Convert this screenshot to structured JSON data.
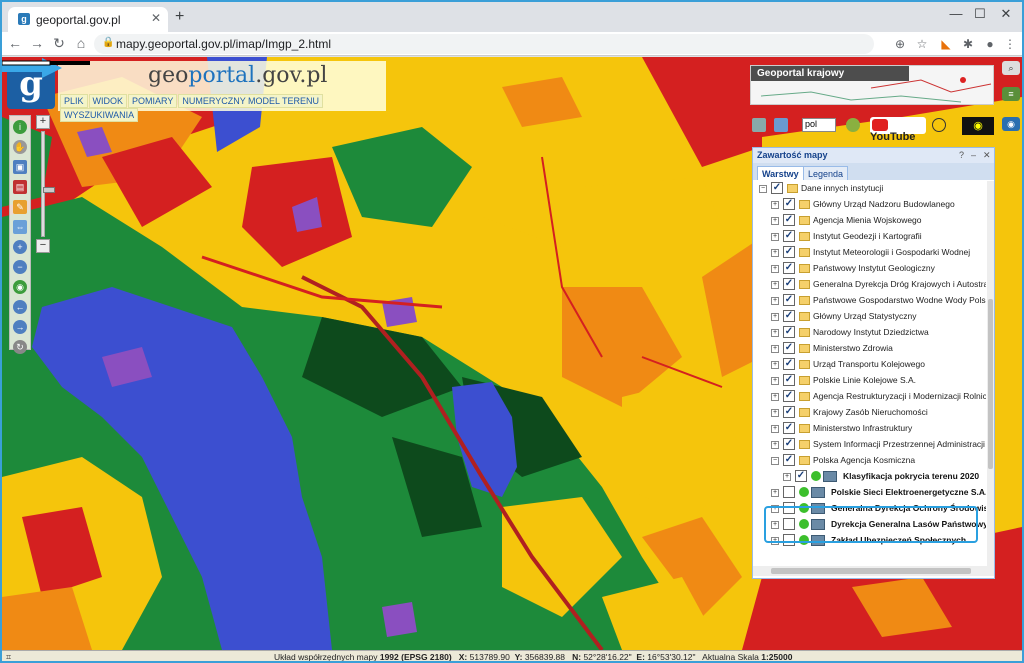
{
  "browser": {
    "tab_title": "geoportal.gov.pl",
    "url": "mapy.geoportal.gov.pl/imap/Imgp_2.html"
  },
  "app": {
    "brand_prefix": "geo",
    "brand_highlight": "portal",
    "brand_suffix": ".gov.pl",
    "menu": [
      "PLIK",
      "WIDOK",
      "POMIARY",
      "NUMERYCZNY MODEL TERENU",
      "WYSZUKIWANIA"
    ],
    "krajowy_title": "Geoportal krajowy",
    "language": "pol",
    "youtube_label": "YouTube"
  },
  "panel": {
    "title": "Zawartość mapy",
    "tab_layers": "Warstwy",
    "tab_legend": "Legenda",
    "rows": [
      {
        "label": "Dane innych instytucji",
        "level": 0,
        "exp": "−",
        "checked": true,
        "folder": true,
        "big": false
      },
      {
        "label": "Główny Urząd Nadzoru Budowlanego",
        "level": 1,
        "exp": "+",
        "checked": true,
        "folder": true,
        "big": false
      },
      {
        "label": "Agencja Mienia Wojskowego",
        "level": 1,
        "exp": "+",
        "checked": true,
        "folder": true,
        "big": false
      },
      {
        "label": "Instytut Geodezji i Kartografii",
        "level": 1,
        "exp": "+",
        "checked": true,
        "folder": true,
        "big": false
      },
      {
        "label": "Instytut Meteorologii i Gospodarki Wodnej",
        "level": 1,
        "exp": "+",
        "checked": true,
        "folder": true,
        "big": false
      },
      {
        "label": "Państwowy Instytut Geologiczny",
        "level": 1,
        "exp": "+",
        "checked": true,
        "folder": true,
        "big": false
      },
      {
        "label": "Generalna Dyrekcja Dróg Krajowych i Autostrad",
        "level": 1,
        "exp": "+",
        "checked": true,
        "folder": true,
        "big": false
      },
      {
        "label": "Państwowe Gospodarstwo Wodne Wody Polskie",
        "level": 1,
        "exp": "+",
        "checked": true,
        "folder": true,
        "big": false
      },
      {
        "label": "Główny Urząd Statystyczny",
        "level": 1,
        "exp": "+",
        "checked": true,
        "folder": true,
        "big": false
      },
      {
        "label": "Narodowy Instytut Dziedzictwa",
        "level": 1,
        "exp": "+",
        "checked": true,
        "folder": true,
        "big": false
      },
      {
        "label": "Ministerstwo Zdrowia",
        "level": 1,
        "exp": "+",
        "checked": true,
        "folder": true,
        "big": false
      },
      {
        "label": "Urząd Transportu Kolejowego",
        "level": 1,
        "exp": "+",
        "checked": true,
        "folder": true,
        "big": false
      },
      {
        "label": "Polskie Linie Kolejowe S.A.",
        "level": 1,
        "exp": "+",
        "checked": true,
        "folder": true,
        "big": false
      },
      {
        "label": "Agencja Restrukturyzacji i Modernizacji Rolnictwa",
        "level": 1,
        "exp": "+",
        "checked": true,
        "folder": true,
        "big": false
      },
      {
        "label": "Krajowy Zasób Nieruchomości",
        "level": 1,
        "exp": "+",
        "checked": true,
        "folder": true,
        "big": false
      },
      {
        "label": "Ministerstwo Infrastruktury",
        "level": 1,
        "exp": "+",
        "checked": true,
        "folder": true,
        "big": false
      },
      {
        "label": "System Informacji Przestrzennej Administracji N",
        "level": 1,
        "exp": "+",
        "checked": true,
        "folder": true,
        "big": false
      },
      {
        "label": "Polska Agencja Kosmiczna",
        "level": 1,
        "exp": "−",
        "checked": true,
        "folder": true,
        "big": false
      },
      {
        "label": "Klasyfikacja pokrycia terenu 2020",
        "level": 2,
        "exp": "+",
        "checked": true,
        "folder": false,
        "big": true
      },
      {
        "label": "Polskie Sieci Elektroenergetyczne S.A.",
        "level": 1,
        "exp": "+",
        "checked": false,
        "folder": false,
        "big": true
      },
      {
        "label": "Generalna Dyrekcja Ochrony Środowiska",
        "level": 1,
        "exp": "+",
        "checked": false,
        "folder": false,
        "big": true
      },
      {
        "label": "Dyrekcja Generalna Lasów Państwowych",
        "level": 1,
        "exp": "+",
        "checked": false,
        "folder": false,
        "big": true
      },
      {
        "label": "Zakład Ubezpieczeń Społecznych",
        "level": 1,
        "exp": "+",
        "checked": false,
        "folder": false,
        "big": true
      }
    ]
  },
  "status": {
    "system_label": "Układ współrzędnych mapy",
    "system_value": "1992 (EPSG 2180)",
    "x_label": "X:",
    "x_value": "513789.90",
    "y_label": "Y:",
    "y_value": "356839.88",
    "n_label": "N:",
    "n_value": "52°28'16.22\"",
    "e_label": "E:",
    "e_value": "16°53'30.12\"",
    "scale_label": "Aktualna Skala",
    "scale_value": "1:25000"
  },
  "colors": {
    "accent": "#2aa0e0",
    "water": "#3c4fd0",
    "forest": "#1d8a3a",
    "field": "#f5c50c",
    "urban": "#d42020",
    "orange": "#f08a14",
    "purple": "#8a4fc0"
  }
}
